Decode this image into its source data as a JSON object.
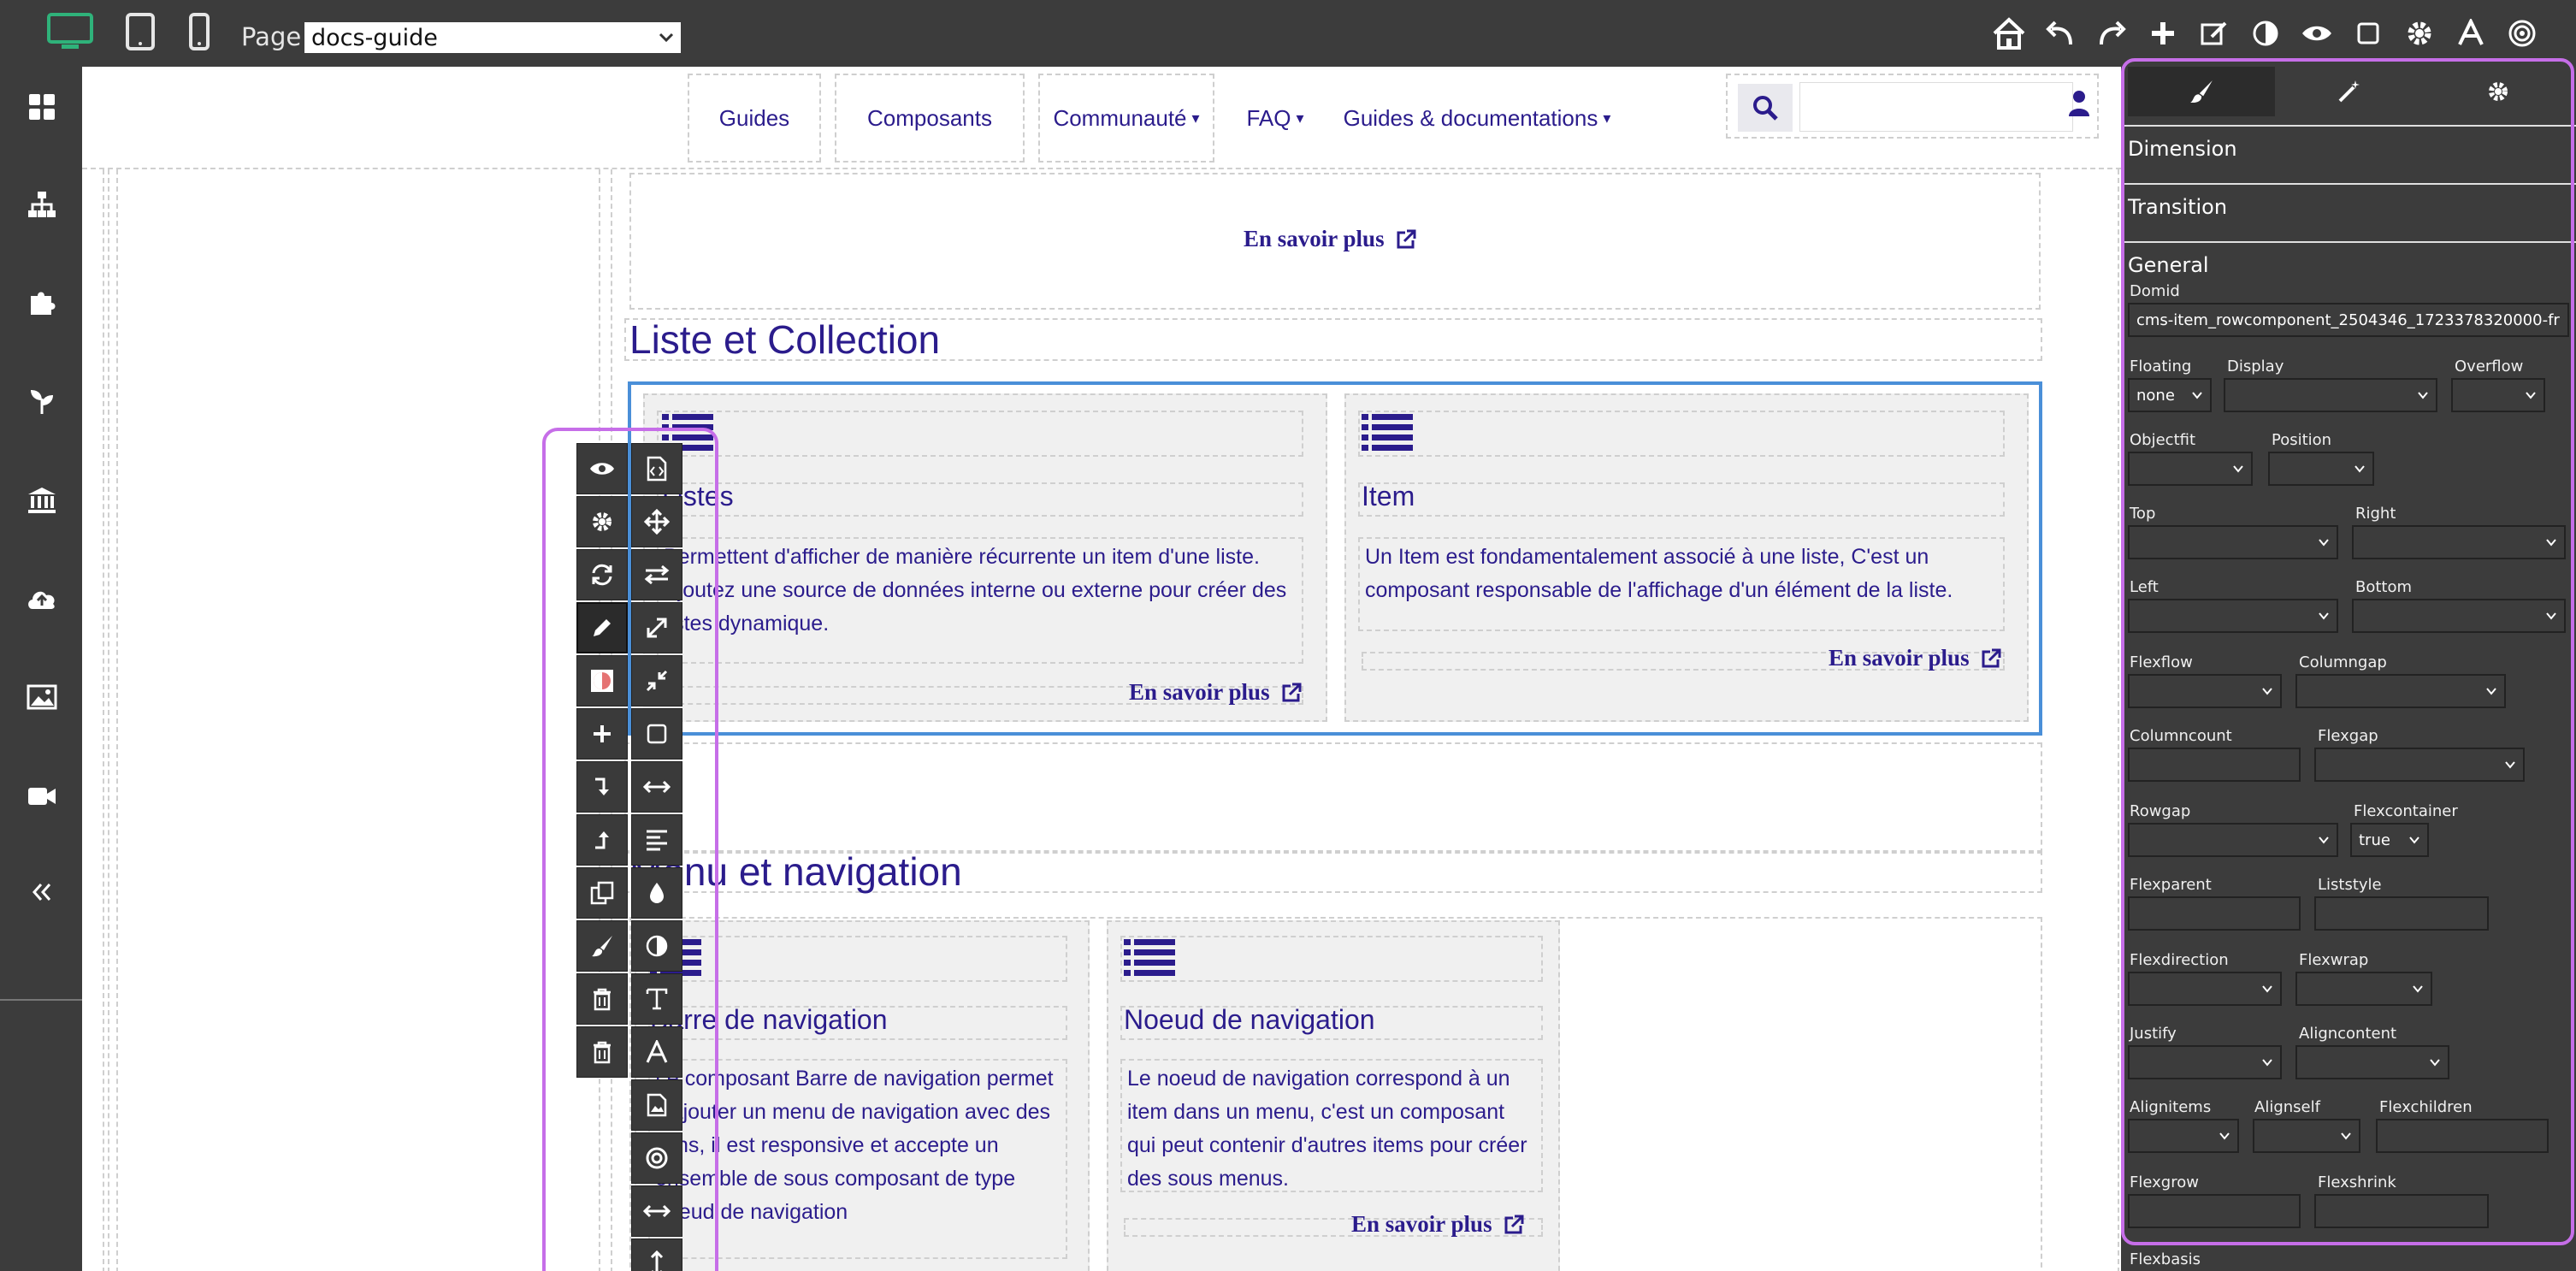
{
  "topbar": {
    "page_label": "Page :",
    "page_value": "docs-guide",
    "colors": {
      "active_device": "#2fb27a"
    }
  },
  "nav": {
    "items": [
      "Guides",
      "Composants",
      "Communauté",
      "FAQ",
      "Guides & documentations"
    ],
    "dropdown_caret": "▾"
  },
  "content": {
    "top_more": "En savoir plus",
    "section1_title": "Liste et Collection",
    "section2_title": "Menu et navigation",
    "cards1": [
      {
        "title": "Listes",
        "text": "Permettent d'afficher de manière récurrente un item d'une liste. Ajoutez une source de données interne ou externe pour créer des listes dynamique.",
        "more": "En savoir plus"
      },
      {
        "title": "Item",
        "text": "Un Item est fondamentalement associé à une liste, C'est un composant responsable de l'affichage d'un élément de la liste.",
        "more": "En savoir plus"
      }
    ],
    "cards2": [
      {
        "title": "Barre de navigation",
        "text": "Le composant Barre de navigation permet d'ajouter un menu de navigation avec des liens, il est responsive et accepte un ensemble de sous composant de type noeud de navigation",
        "more": ""
      },
      {
        "title": "Noeud de navigation",
        "text": "Le noeud de navigation correspond à un item dans un menu, c'est un composant qui peut contenir d'autres items pour créer des sous menus.",
        "more": "En savoir plus"
      }
    ],
    "colors": {
      "brand_text": "#2b1c8c",
      "selection": "#4a8fd8"
    }
  },
  "panel": {
    "sections": {
      "dimension": "Dimension",
      "transition": "Transition",
      "general": "General"
    },
    "domid_label": "Domid",
    "domid_value": "cms-item_rowcomponent_2504346_1723378320000-fr",
    "labels": {
      "floating": "Floating",
      "display": "Display",
      "overflow": "Overflow",
      "objectfit": "Objectfit",
      "position": "Position",
      "top": "Top",
      "right": "Right",
      "left": "Left",
      "bottom": "Bottom",
      "flexflow": "Flexflow",
      "columngap": "Columngap",
      "columncount": "Columncount",
      "flexgap": "Flexgap",
      "rowgap": "Rowgap",
      "flexcontainer": "Flexcontainer",
      "flexparent": "Flexparent",
      "liststyle": "Liststyle",
      "flexdirection": "Flexdirection",
      "flexwrap": "Flexwrap",
      "justify": "Justify",
      "aligncontent": "Aligncontent",
      "alignitems": "Alignitems",
      "alignself": "Alignself",
      "flexchildren": "Flexchildren",
      "flexgrow": "Flexgrow",
      "flexshrink": "Flexshrink",
      "flexbasis": "Flexbasis"
    },
    "values": {
      "floating": "none",
      "flexcontainer": "true"
    },
    "colors": {
      "highlight": "#c66ee8"
    }
  }
}
